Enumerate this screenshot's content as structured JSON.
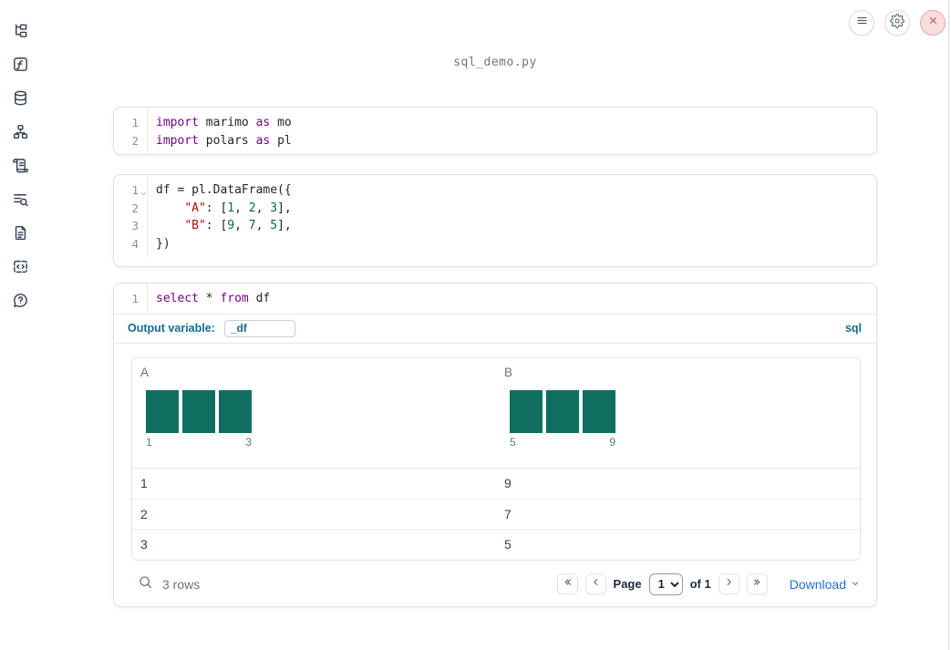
{
  "window": {
    "title": "sql_demo.py"
  },
  "topbar": {
    "buttons": [
      {
        "icon": "menu-icon"
      },
      {
        "icon": "gear-icon"
      },
      {
        "icon": "close-icon"
      }
    ]
  },
  "sidebar": {
    "items": [
      {
        "icon": "file-tree-icon"
      },
      {
        "icon": "function-icon"
      },
      {
        "icon": "database-icon"
      },
      {
        "icon": "dependency-graph-icon"
      },
      {
        "icon": "scroll-icon"
      },
      {
        "icon": "logs-search-icon"
      },
      {
        "icon": "document-icon"
      },
      {
        "icon": "snippets-icon"
      },
      {
        "icon": "help-icon"
      }
    ]
  },
  "cells": [
    {
      "lines": [
        {
          "n": "1",
          "tokens": [
            [
              "kw",
              "import"
            ],
            [
              "tx",
              " marimo "
            ],
            [
              "kw",
              "as"
            ],
            [
              "tx",
              " mo"
            ]
          ]
        },
        {
          "n": "2",
          "tokens": [
            [
              "kw",
              "import"
            ],
            [
              "tx",
              " polars "
            ],
            [
              "kw",
              "as"
            ],
            [
              "tx",
              " pl"
            ]
          ]
        }
      ]
    },
    {
      "lines": [
        {
          "n": "1",
          "fold": true,
          "tokens": [
            [
              "tx",
              "df = pl.DataFrame({"
            ]
          ]
        },
        {
          "n": "2",
          "tokens": [
            [
              "tx",
              "    "
            ],
            [
              "st",
              "\"A\""
            ],
            [
              "tx",
              ": ["
            ],
            [
              "nm",
              "1"
            ],
            [
              "tx",
              ", "
            ],
            [
              "nm",
              "2"
            ],
            [
              "tx",
              ", "
            ],
            [
              "nm",
              "3"
            ],
            [
              "tx",
              "],"
            ]
          ]
        },
        {
          "n": "3",
          "tokens": [
            [
              "tx",
              "    "
            ],
            [
              "st",
              "\"B\""
            ],
            [
              "tx",
              ": ["
            ],
            [
              "nm",
              "9"
            ],
            [
              "tx",
              ", "
            ],
            [
              "nm",
              "7"
            ],
            [
              "tx",
              ", "
            ],
            [
              "nm",
              "5"
            ],
            [
              "tx",
              "],"
            ]
          ]
        },
        {
          "n": "4",
          "tokens": [
            [
              "tx",
              "})"
            ]
          ]
        }
      ]
    },
    {
      "lines": [
        {
          "n": "1",
          "tokens": [
            [
              "kw",
              "select"
            ],
            [
              "tx",
              " * "
            ],
            [
              "kw",
              "from"
            ],
            [
              "tx",
              " df"
            ]
          ]
        }
      ]
    }
  ],
  "sql_cell": {
    "output_variable_label": "Output variable:",
    "output_variable_value": "_df",
    "language_badge": "sql"
  },
  "table": {
    "columns": [
      {
        "name": "A",
        "histogram": {
          "bars": [
            1,
            1,
            1
          ],
          "min_label": "1",
          "max_label": "3"
        }
      },
      {
        "name": "B",
        "histogram": {
          "bars": [
            1,
            1,
            1
          ],
          "min_label": "5",
          "max_label": "9"
        }
      }
    ],
    "rows": [
      [
        "1",
        "9"
      ],
      [
        "2",
        "7"
      ],
      [
        "3",
        "5"
      ]
    ],
    "footer": {
      "row_count": "3 rows",
      "page_label": "Page",
      "page_value": "1",
      "of_label": "of 1",
      "download_label": "Download"
    }
  },
  "colors": {
    "histogram_bar": "#0f6e5f",
    "keyword": "#770088",
    "string": "#a11111",
    "number": "#116644",
    "accent_blue": "#156a93",
    "link_blue": "#2270d8"
  }
}
